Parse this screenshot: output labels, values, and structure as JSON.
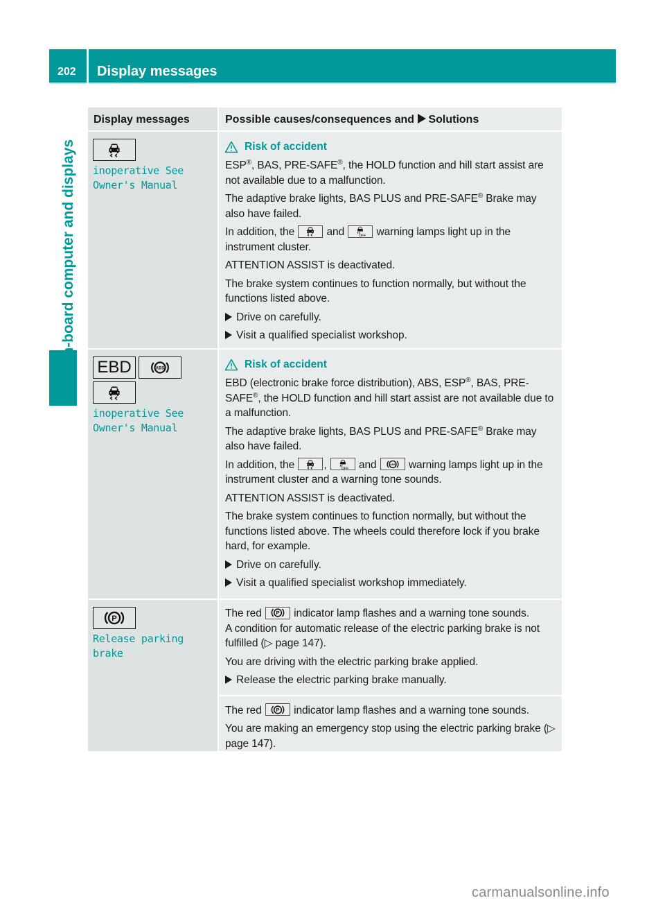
{
  "header": {
    "page_number": "202",
    "title": "Display messages"
  },
  "side_tab": {
    "label": "On-board computer and displays"
  },
  "table": {
    "columns": {
      "display": "Display messages",
      "causes_pre": "Possible causes/consequences and",
      "causes_post": "Solutions"
    },
    "rows": [
      {
        "icons": [
          "esp-skid-icon"
        ],
        "message_lines": [
          "inoperative See",
          "Owner's Manual"
        ],
        "risk_label": "Risk of accident",
        "p1_a": "ESP",
        "p1_b": ", BAS, PRE-SAFE",
        "p1_c": ", the HOLD function and hill start assist are not available due to a malfunction.",
        "p2_a": "The adaptive brake lights, BAS PLUS and PRE-SAFE",
        "p2_b": " Brake may also have failed.",
        "p3_a": "In addition, the",
        "p3_b": "and",
        "p3_c": "warning lamps light up in the instrument cluster.",
        "p4": "ATTENTION ASSIST is deactivated.",
        "p5": "The brake system continues to function normally, but without the functions listed above.",
        "steps": [
          "Drive on carefully.",
          "Visit a qualified specialist workshop."
        ]
      },
      {
        "icons": [
          "ebd-icon",
          "abs-icon",
          "esp-skid-icon"
        ],
        "ebd_text": "EBD",
        "message_lines": [
          "inoperative See",
          "Owner's Manual"
        ],
        "risk_label": "Risk of accident",
        "p1_a": "EBD (electronic brake force distribution), ABS, ESP",
        "p1_b": ", BAS, PRE-SAFE",
        "p1_c": ", the HOLD function and hill start assist are not available due to a malfunction.",
        "p2_a": "The adaptive brake lights, BAS PLUS and PRE-SAFE",
        "p2_b": " Brake may also have failed.",
        "p3_a": "In addition, the",
        "p3_b": ",",
        "p3_c": "and",
        "p3_d": "warning lamps light up in the instrument cluster and a warning tone sounds.",
        "p4": "ATTENTION ASSIST is deactivated.",
        "p5": "The brake system continues to function normally, but without the functions listed above. The wheels could therefore lock if you brake hard, for example.",
        "steps": [
          "Drive on carefully.",
          "Visit a qualified specialist workshop immediately."
        ]
      },
      {
        "icons": [
          "parking-brake-icon"
        ],
        "message_lines": [
          "Release parking",
          "brake"
        ],
        "sub1": {
          "p1_a": "The red",
          "p1_b": "indicator lamp flashes and a warning tone sounds.",
          "p2_a": "A condition for automatic release of the electric parking brake is not fulfilled (",
          "p2_ref": "page 147",
          "p2_b": ").",
          "p3": "You are driving with the electric parking brake applied.",
          "steps": [
            "Release the electric parking brake manually."
          ]
        },
        "sub2": {
          "p1_a": "The red",
          "p1_b": "indicator lamp flashes and a warning tone sounds.",
          "p2_a": "You are making an emergency stop using the electric parking brake (",
          "p2_ref": "page 147",
          "p2_b": ")."
        }
      }
    ]
  },
  "symbols": {
    "registered": "®",
    "page_ref_arrow": "▷"
  },
  "colors": {
    "accent": "#009898",
    "cell_dark": "#dde2e2",
    "cell_light": "#e9ecec"
  },
  "watermark": "carmanualsonline.info"
}
